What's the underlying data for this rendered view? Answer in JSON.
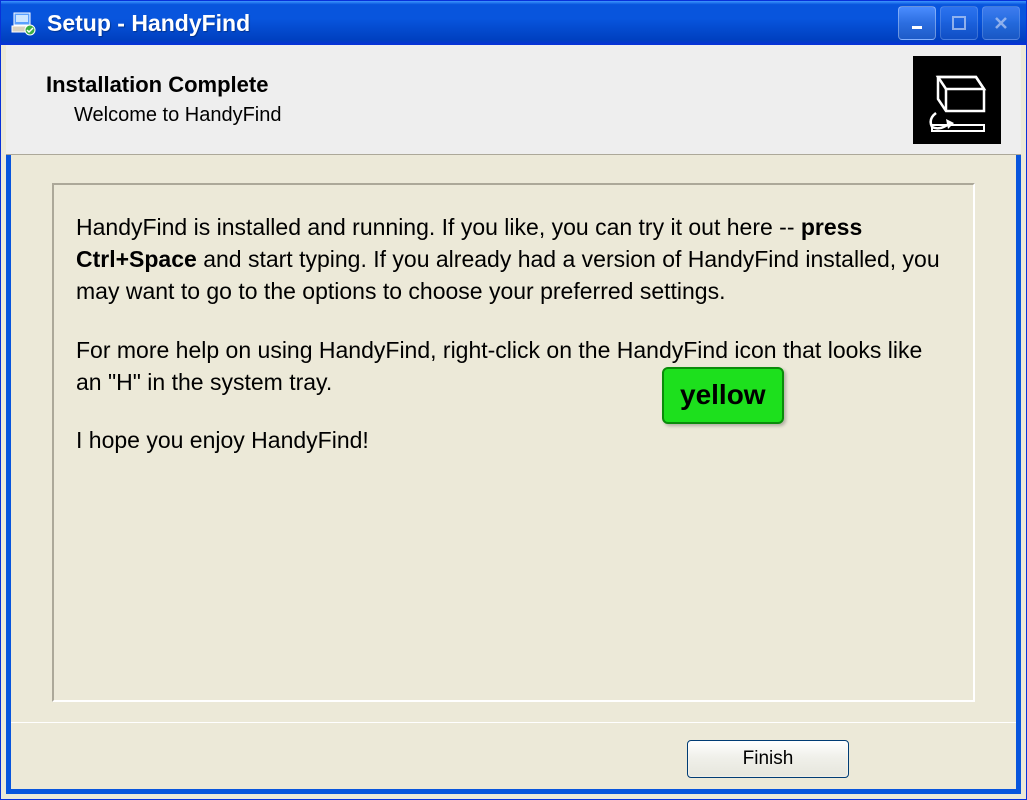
{
  "titlebar": {
    "text": "Setup - HandyFind"
  },
  "header": {
    "title": "Installation Complete",
    "subtitle": "Welcome to HandyFind"
  },
  "content": {
    "p1_a": "HandyFind is installed and running. If you like, you can try it out here -- ",
    "p1_bold": "press Ctrl+Space",
    "p1_b": " and start typing. If you already had a version of HandyFind installed, you may want to go to the options to choose your preferred settings.",
    "p2": "For more help on using HandyFind, right-click on the HandyFind icon that looks like an \"H\" in the system tray.",
    "p3": "I hope you enjoy HandyFind!"
  },
  "overlay": {
    "text": "yellow"
  },
  "buttons": {
    "finish": "Finish"
  }
}
